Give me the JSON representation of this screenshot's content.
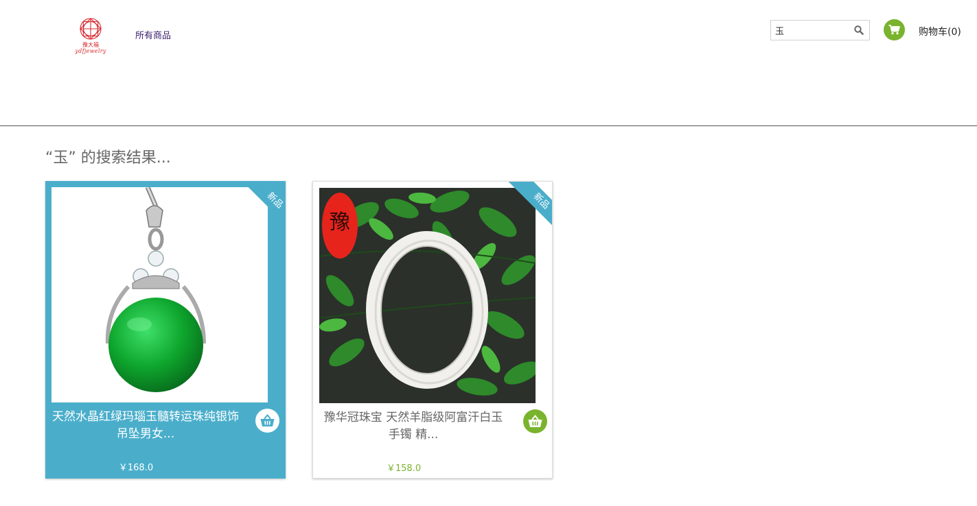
{
  "header": {
    "logo_brand": "ydfjewelry",
    "logo_cn": "豫大福",
    "nav_all_products": "所有商品",
    "search": {
      "value": "玉",
      "icon": "search-icon"
    },
    "cart": {
      "label": "购物车(0)",
      "icon": "cart-icon"
    },
    "colors": {
      "accent_blue": "#4aaecb",
      "accent_green": "#7ab32e",
      "logo_red": "#d8282f"
    }
  },
  "results": {
    "title": "“玉” 的搜索结果..."
  },
  "products": [
    {
      "name": "天然水晶红绿玛瑙玉髓转运珠纯银饰吊坠男女...",
      "price": "￥168.0",
      "badge": "新品",
      "image": "green-jade-pendant",
      "cart_icon": "basket-icon"
    },
    {
      "name": "豫华冠珠宝 天然羊脂级阿富汗白玉手镯 精...",
      "price": "￥158.0",
      "badge": "新品",
      "image": "white-jade-bangle",
      "cart_icon": "basket-icon",
      "brand_seal": "豫"
    }
  ]
}
